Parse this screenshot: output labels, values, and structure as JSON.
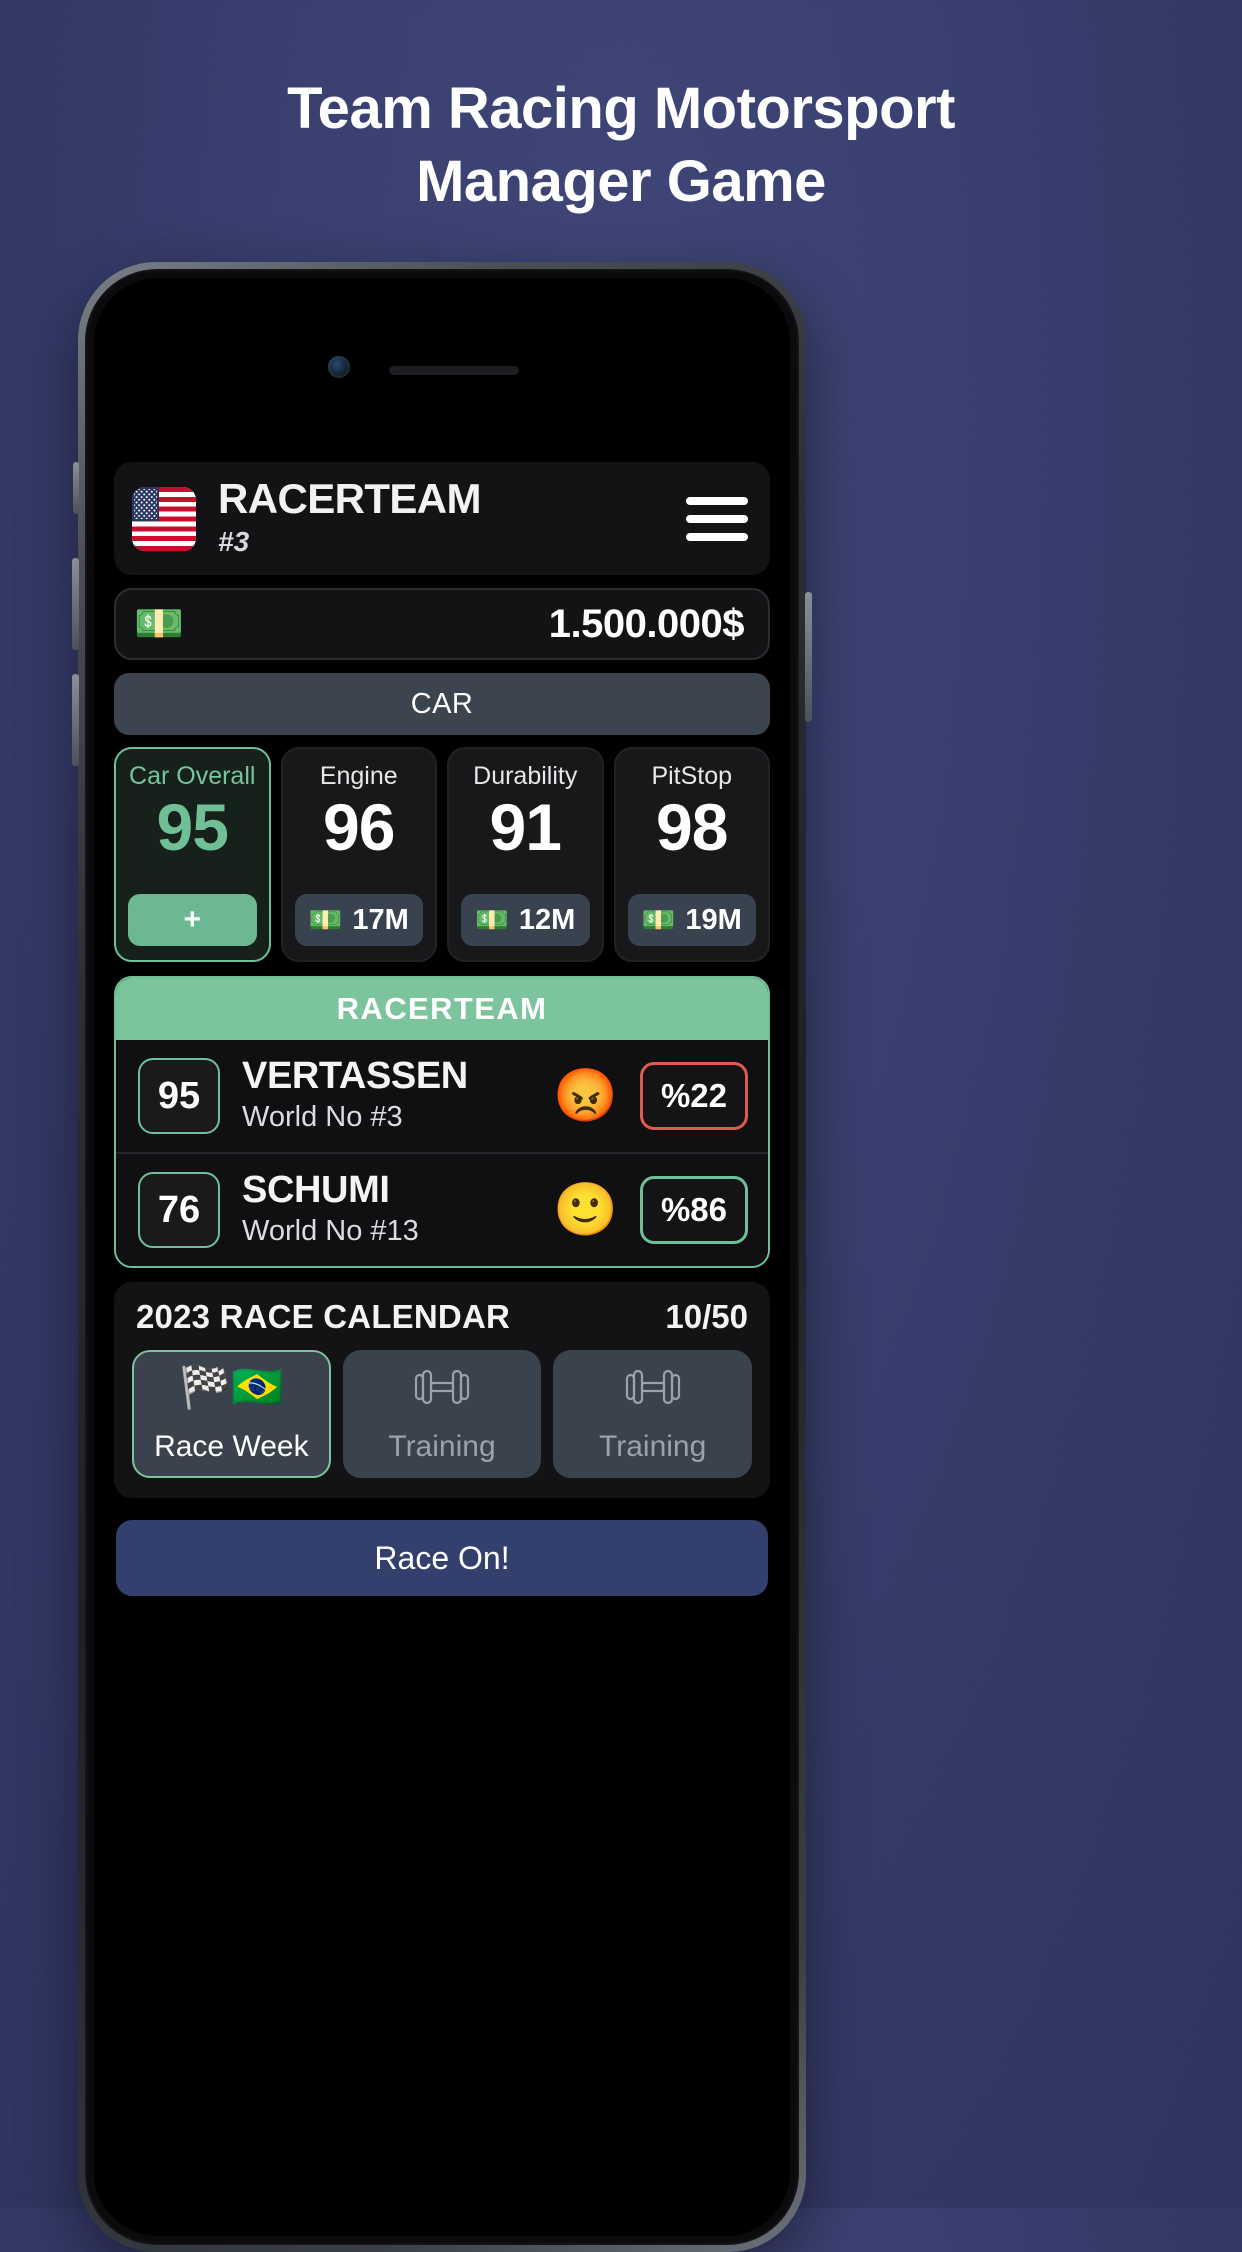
{
  "headline": {
    "line1": "Team Racing Motorsport",
    "line2": "Manager Game"
  },
  "app": {
    "team": {
      "name": "RACERTEAM",
      "rank": "#3",
      "flag": "us-flag-icon",
      "menu_icon": "hamburger-menu-icon"
    },
    "money": {
      "icon": "money-banknote-icon",
      "value": "1.500.000$"
    },
    "car_section": {
      "title": "CAR"
    },
    "car_stats": [
      {
        "label": "Car Overall",
        "value": "95",
        "action": "+",
        "primary": true
      },
      {
        "label": "Engine",
        "value": "96",
        "price": "17M",
        "primary": false
      },
      {
        "label": "Durability",
        "value": "91",
        "price": "12M",
        "primary": false
      },
      {
        "label": "PitStop",
        "value": "98",
        "price": "19M",
        "primary": false
      }
    ],
    "drivers_header": "RACERTEAM",
    "drivers": [
      {
        "overall": "95",
        "name": "VERTASSEN",
        "world": "World No #3",
        "mood": "angry-face-icon",
        "mood_glyph": "😡",
        "percent": "%22",
        "percent_state": "bad"
      },
      {
        "overall": "76",
        "name": "SCHUMI",
        "world": "World No #13",
        "mood": "slightly-smiling-face-icon",
        "mood_glyph": "🙂",
        "percent": "%86",
        "percent_state": "good"
      }
    ],
    "calendar": {
      "title": "2023 RACE CALENDAR",
      "count": "10/50",
      "items": [
        {
          "label": "Race Week",
          "icons": "🏁🇧🇷",
          "type": "race",
          "active": true
        },
        {
          "label": "Training",
          "icons": "",
          "type": "training",
          "active": false
        },
        {
          "label": "Training",
          "icons": "",
          "type": "training",
          "active": false
        }
      ]
    },
    "race_button": "Race On!"
  },
  "colors": {
    "accent_green": "#7cc49c",
    "bad_red": "#e05a4e",
    "section_grey": "#3c444f",
    "race_blue": "#33406e",
    "background": "#3a4070"
  }
}
